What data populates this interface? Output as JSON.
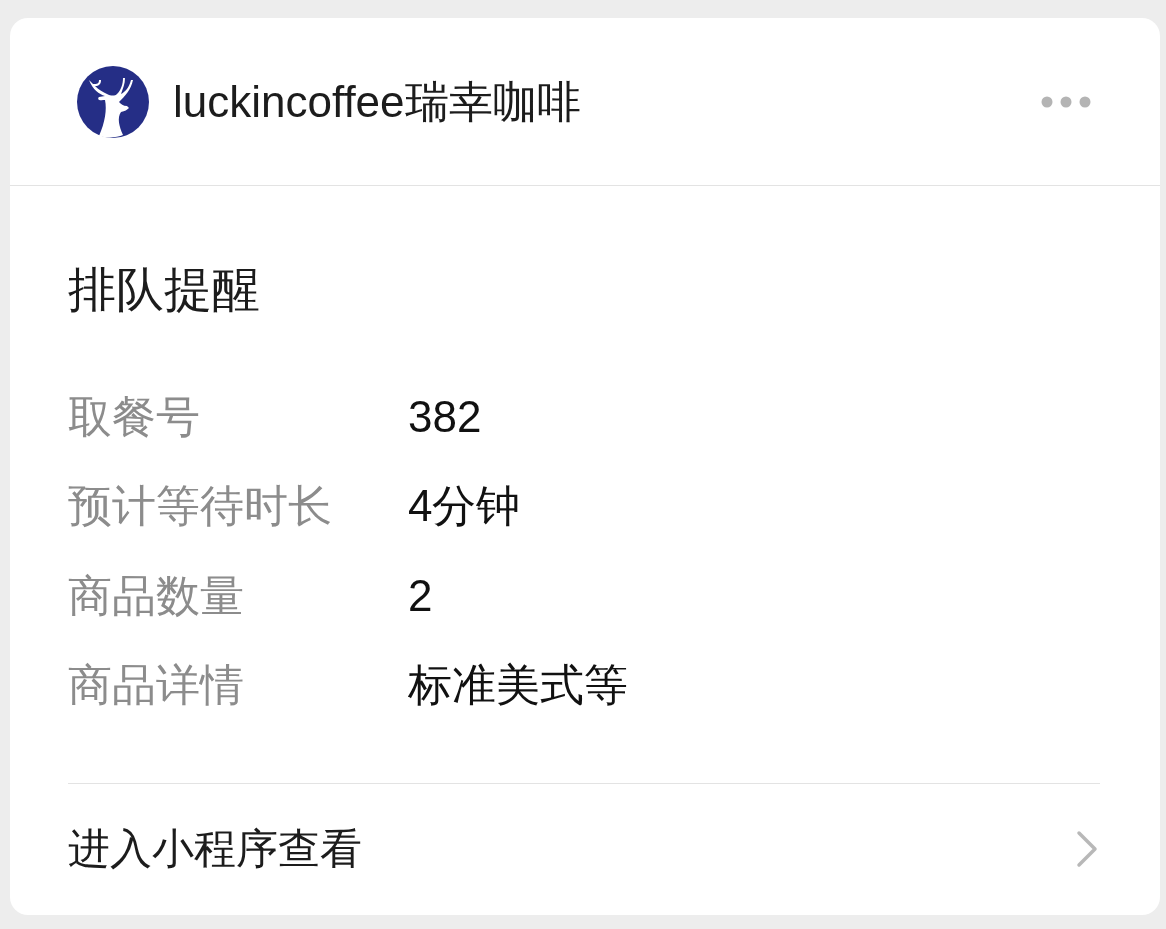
{
  "header": {
    "title": "luckincoffee瑞幸咖啡"
  },
  "notice": {
    "title": "排队提醒",
    "rows": [
      {
        "label": "取餐号",
        "value": "382"
      },
      {
        "label": "预计等待时长",
        "value": "4分钟"
      },
      {
        "label": "商品数量",
        "value": "2"
      },
      {
        "label": "商品详情",
        "value": "标准美式等"
      }
    ]
  },
  "footer": {
    "link": "进入小程序查看"
  }
}
